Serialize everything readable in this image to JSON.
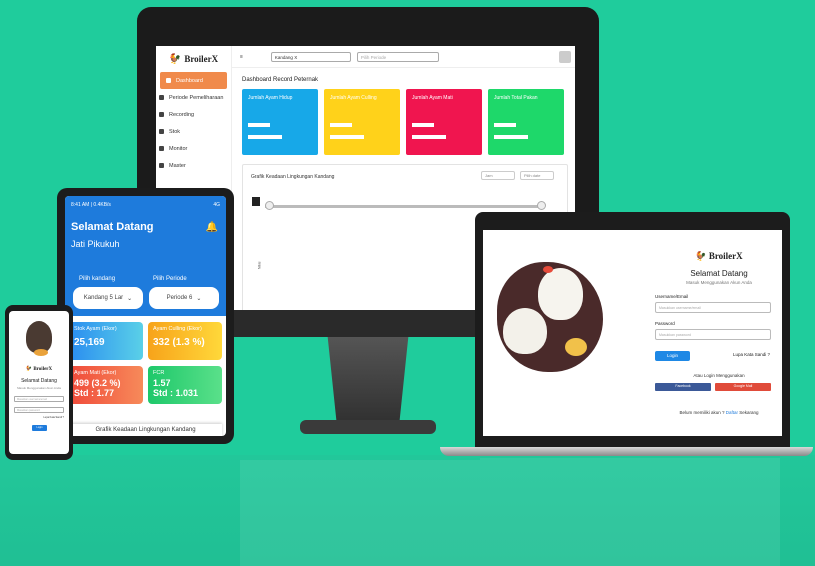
{
  "desktop": {
    "brand": "BroilerX",
    "sidebar": [
      {
        "label": "Dashboard",
        "active": true
      },
      {
        "label": "Periode Pemeliharaan",
        "active": false
      },
      {
        "label": "Recording",
        "active": false
      },
      {
        "label": "Stok",
        "active": false
      },
      {
        "label": "Monitor",
        "active": false
      },
      {
        "label": "Master",
        "active": false
      }
    ],
    "menu_icon": "≡",
    "kandang_select": "Kandang X",
    "periode_placeholder": "Pilih Periode",
    "title": "Dashboard Record Peternak",
    "cards": [
      {
        "label": "Jumlah Ayam Hidup",
        "color": "#17a8e8"
      },
      {
        "label": "Jumlah Ayam Culling",
        "color": "#ffd21a"
      },
      {
        "label": "Jumlah Ayam Mati",
        "color": "#f0154f"
      },
      {
        "label": "Jumlah Total Pakan",
        "color": "#1ed86a"
      }
    ],
    "chart_title": "Grafik Keadaan Lingkungan Kandang",
    "chart_unit_select": "Jam",
    "chart_date_placeholder": "Pilih date",
    "chart_ylabel": "Nilai"
  },
  "tablet": {
    "status_left": "8:41 AM | 0.4KB/s",
    "status_right": "4G",
    "welcome": "Selamat Datang",
    "user": "Jati Pikukuh",
    "kandang_label": "Pilih kandang",
    "periode_label": "Pilih Periode",
    "kandang_value": "Kandang 5 Lar",
    "periode_value": "Periode 6",
    "cards": [
      {
        "label": "Stok Ayam (Ekor)",
        "value": "25,169",
        "extra": "",
        "colors": [
          "#2a8df0",
          "#5ad0e8"
        ]
      },
      {
        "label": "Ayam Culling (Ekor)",
        "value": "332 (1.3 %)",
        "extra": "",
        "colors": [
          "#f7a31a",
          "#ffd83a"
        ]
      },
      {
        "label": "Ayam Mati (Ekor)",
        "value": "499 (3.2 %)",
        "extra": "Std : 1.77",
        "colors": [
          "#f04a3a",
          "#f78a5a"
        ]
      },
      {
        "label": "FCR",
        "value": "1.57",
        "extra": "Std : 1.031",
        "colors": [
          "#1ec86a",
          "#5ae08a"
        ]
      }
    ],
    "grafik": "Grafik Keadaan Lingkungan Kandang"
  },
  "phone": {
    "brand": "BroilerX",
    "welcome": "Selamat Datang",
    "sub": "Masuk Menggunakan Akun Anda",
    "email_placeholder": "Masukkan username/email",
    "password_placeholder": "Masukkan password",
    "forgot": "Lupa Kata Sandi ?",
    "login": "Login"
  },
  "laptop": {
    "brand": "BroilerX",
    "welcome": "Selamat Datang",
    "sub": "Masuk Menggunakan Akun Anda",
    "username_label": "Username/Email",
    "username_placeholder": "Masukkan username/email",
    "password_label": "Password",
    "password_placeholder": "Masukkan password",
    "login": "Login",
    "forgot": "Lupa Kata Sandi ?",
    "alt": "Atau Login Menggunakan",
    "facebook": "Facebook",
    "google": "Google Mail",
    "register_prefix": "Belum memiliki akun ?",
    "register_link": "Daftar",
    "register_suffix": "Sekarang"
  }
}
